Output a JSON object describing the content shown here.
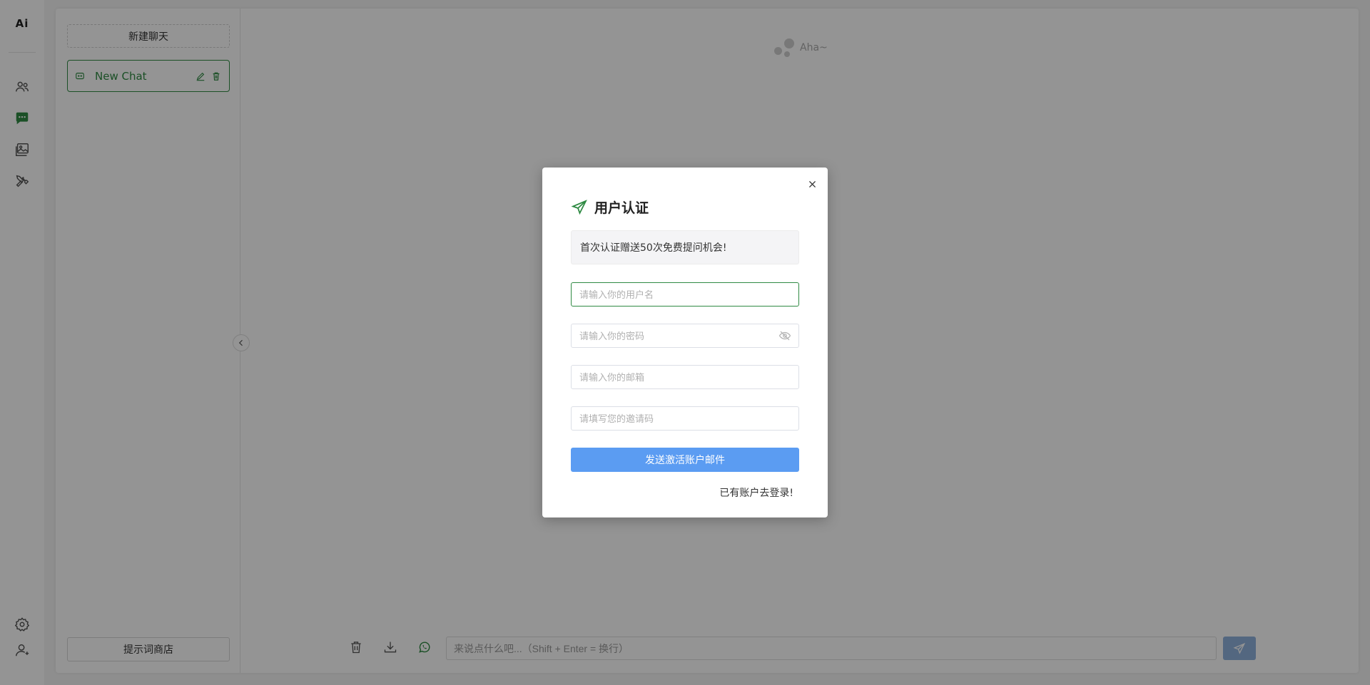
{
  "logo": "Ai",
  "sidebar": {
    "icons": [
      {
        "name": "users-icon"
      },
      {
        "name": "chat-icon",
        "active": true
      },
      {
        "name": "images-icon"
      },
      {
        "name": "tools-icon"
      }
    ],
    "bottom_icons": [
      {
        "name": "settings-icon"
      },
      {
        "name": "user-profile-icon"
      }
    ]
  },
  "chat_panel": {
    "new_chat_label": "新建聊天",
    "chats": [
      {
        "title": "New Chat"
      }
    ],
    "prompt_store_label": "提示词商店"
  },
  "main": {
    "assistant_name": "Aha~",
    "input_placeholder": "来说点什么吧...（Shift + Enter = 换行）"
  },
  "modal": {
    "title": "用户认证",
    "notice": "首次认证赠送50次免费提问机会!",
    "username_placeholder": "请输入你的用户名",
    "password_placeholder": "请输入你的密码",
    "email_placeholder": "请输入你的邮箱",
    "invite_placeholder": "请填写您的邀请码",
    "submit_label": "发送激活账户邮件",
    "login_link": "已有账户去登录!"
  },
  "colors": {
    "accent_green": "#2f8a43",
    "button_blue": "#5b9cf2",
    "send_button": "#8fb1dc",
    "overlay": "rgba(0,0,0,0.42)"
  }
}
